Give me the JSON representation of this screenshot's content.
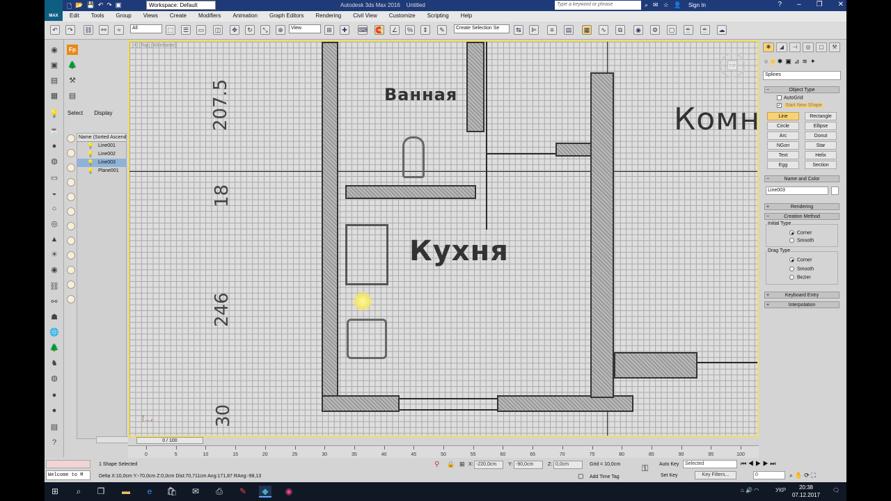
{
  "window": {
    "title": "Autodesk 3ds Max 2016",
    "file": "Untitled",
    "workspace": "Workspace: Default",
    "search_placeholder": "Type a keyword or phrase",
    "signin": "Sign In",
    "logo": "MAX"
  },
  "menu": [
    "Edit",
    "Tools",
    "Group",
    "Views",
    "Create",
    "Modifiers",
    "Animation",
    "Graph Editors",
    "Rendering",
    "Civil View",
    "Customize",
    "Scripting",
    "Help"
  ],
  "toolbar": {
    "filter": "All",
    "view": "View",
    "selection_set": "Create Selection Se"
  },
  "scene": {
    "tabs": [
      "Select",
      "Display"
    ],
    "column": "Name (Sorted Ascend",
    "objects": [
      {
        "name": "Line001",
        "selected": false
      },
      {
        "name": "Line002",
        "selected": false
      },
      {
        "name": "Line003",
        "selected": true
      },
      {
        "name": "Plane001",
        "selected": false
      }
    ]
  },
  "viewport": {
    "label": "[+] [Top] [Wireframe]",
    "rooms": {
      "bath": "Ванная",
      "kitchen": "Кухня",
      "room": "Комн"
    },
    "dims": [
      "207.5",
      "18",
      "246",
      "30"
    ]
  },
  "command": {
    "category": "Splines",
    "object_type": "Object Type",
    "autogrid": "AutoGrid",
    "start_new_shape": "Start New Shape",
    "buttons": [
      "Line",
      "Rectangle",
      "Circle",
      "Ellipse",
      "Arc",
      "Donut",
      "NGon",
      "Star",
      "Text",
      "Helix",
      "Egg",
      "Section"
    ],
    "active_button": "Line",
    "name_color": "Name and Color",
    "object_name": "Line003",
    "rendering": "Rendering",
    "creation_method": "Creation Method",
    "initial_type": "Initial Type",
    "initial_options": [
      "Corner",
      "Smooth"
    ],
    "drag_type": "Drag Type",
    "drag_options": [
      "Corner",
      "Smooth",
      "Bezier"
    ],
    "keyboard_entry": "Keyboard Entry",
    "interpolation": "Interpolation"
  },
  "timeline": {
    "frame": "0 / 100",
    "ticks": [
      "0",
      "5",
      "10",
      "15",
      "20",
      "25",
      "30",
      "35",
      "40",
      "45",
      "50",
      "55",
      "60",
      "65",
      "70",
      "75",
      "80",
      "85",
      "90",
      "95",
      "100"
    ]
  },
  "status": {
    "selected": "1 Shape Selected",
    "prompt": "Delta X:10,0cm  Y:-70,0cm  Z:0,0cm  Dist:70,711cm  Ang:171,87 RAng:-98,13",
    "x": "-220,0cm",
    "y": "-90,0cm",
    "z": "0,0cm",
    "x_lbl": "X:",
    "y_lbl": "Y:",
    "z_lbl": "Z:",
    "grid": "Grid = 10,0cm",
    "add_time_tag": "Add Time Tag",
    "auto_key": "Auto Key",
    "set_key": "Set Key",
    "selected_dd": "Selected",
    "key_filters": "Key Filters...",
    "frame_field": "0",
    "welcome": "Welcome to M"
  },
  "taskbar": {
    "lang": "УКР",
    "time": "20:38",
    "date": "07.12.2017"
  }
}
